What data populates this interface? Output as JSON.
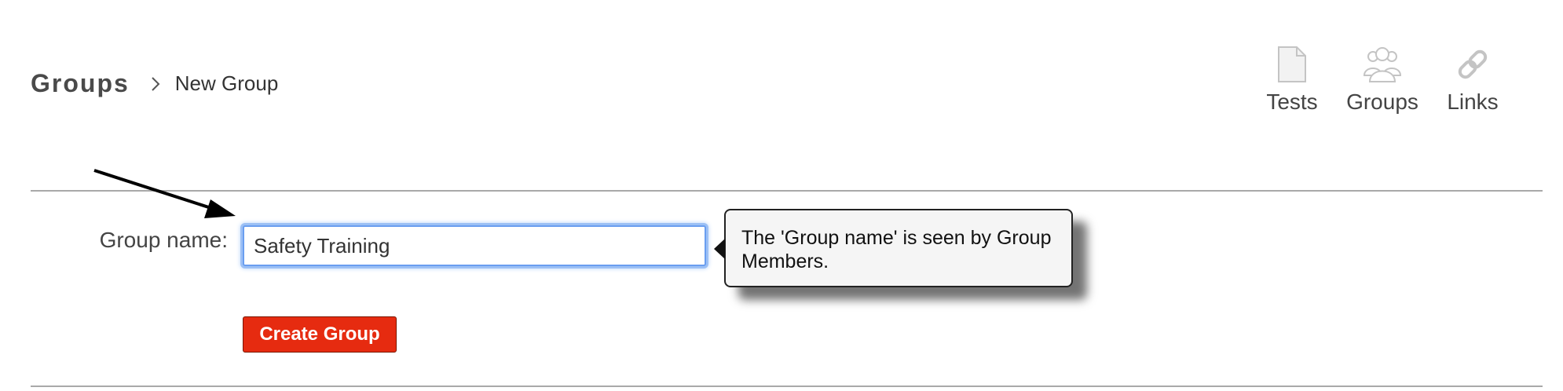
{
  "breadcrumb": {
    "root": "Groups",
    "separator_icon": "chevron-right-icon",
    "current": "New Group"
  },
  "nav": {
    "items": [
      {
        "label": "Tests",
        "icon": "document-icon"
      },
      {
        "label": "Groups",
        "icon": "users-icon"
      },
      {
        "label": "Links",
        "icon": "link-icon"
      }
    ],
    "icon_color": "#c4c4c4"
  },
  "form": {
    "group_name_label": "Group name:",
    "group_name_value": "Safety Training",
    "tooltip_text": "The 'Group name' is seen by Group Members.",
    "create_button_label": "Create Group"
  },
  "colors": {
    "accent_button": "#e62b10",
    "focus_ring": "#6a9ef0",
    "divider": "#a9a9a9"
  }
}
